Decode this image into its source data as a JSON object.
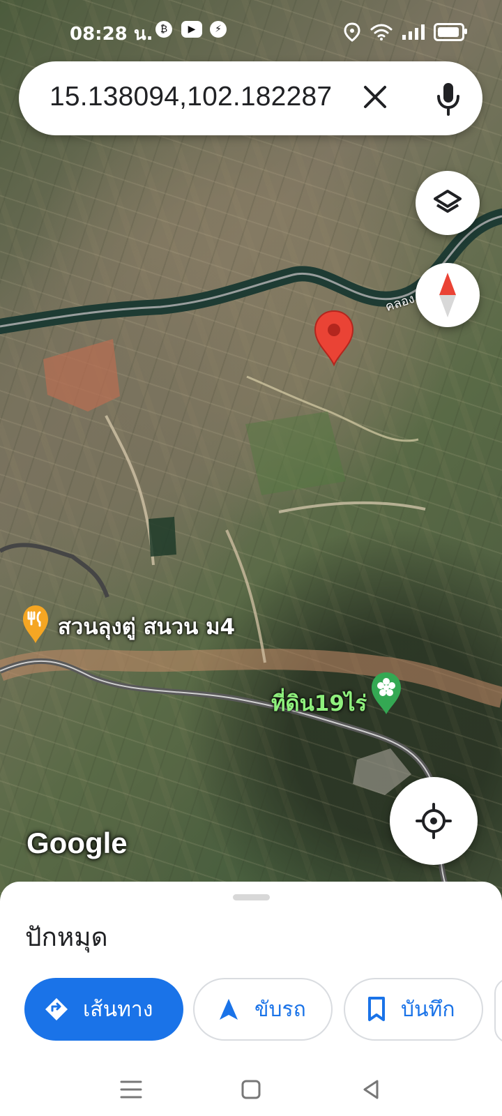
{
  "status_bar": {
    "time": "08:28 น.",
    "apps": [
      {
        "name": "b-circle-icon",
        "symbol": "₿"
      },
      {
        "name": "youtube-icon",
        "symbol": "▶"
      },
      {
        "name": "messenger-icon",
        "symbol": "⚡"
      }
    ],
    "icons": [
      "location-icon",
      "wifi-icon",
      "signal-icon",
      "battery-icon"
    ]
  },
  "search": {
    "query": "15.138094,102.182287",
    "clear_icon": "close-icon",
    "mic_icon": "microphone-icon"
  },
  "map": {
    "labels": {
      "road": "คลอง",
      "restaurant": "สวนลุงตู่ สนวน ม4",
      "land": "ที่ดิน19ไร่",
      "google": "Google"
    },
    "colors": {
      "pin": "#ea4335",
      "poi_orange": "#f5a623",
      "poi_green": "#34a853",
      "accent": "#1a73e8"
    },
    "icons": [
      "layers-icon",
      "compass-icon",
      "my-location-icon",
      "map-pin-icon",
      "restaurant-icon",
      "flower-icon"
    ]
  },
  "bottom_sheet": {
    "title": "ปักหมุด",
    "actions": [
      {
        "label": "เส้นทาง",
        "icon": "directions-icon"
      },
      {
        "label": "ขับรถ",
        "icon": "navigation-arrow-icon"
      },
      {
        "label": "บันทึก",
        "icon": "bookmark-icon"
      }
    ]
  },
  "navbar": {
    "buttons": [
      "menu-icon",
      "home-square-icon",
      "back-triangle-icon"
    ]
  }
}
